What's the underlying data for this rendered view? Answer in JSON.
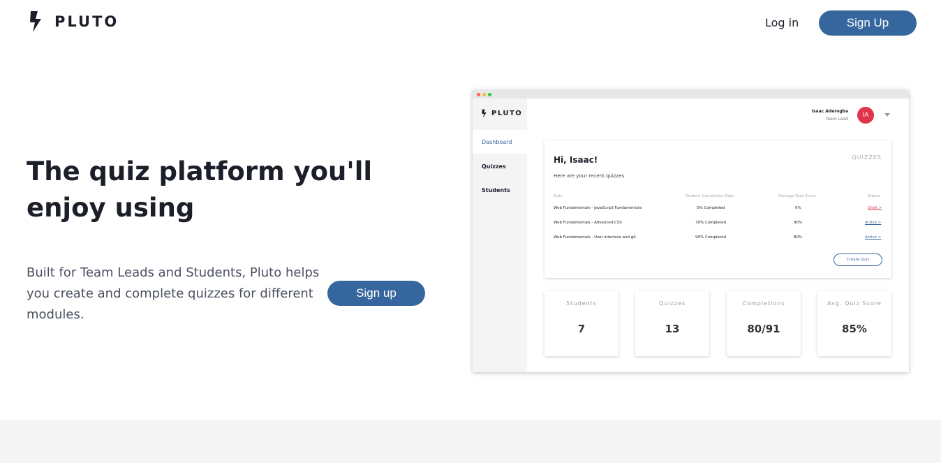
{
  "brand": {
    "name": "PLUTO",
    "icon": "bolt-icon"
  },
  "nav": {
    "login_label": "Log in",
    "signup_label": "Sign Up"
  },
  "hero": {
    "title": "The quiz platform you'll enjoy using",
    "description": "Built for Team Leads and Students, Pluto helps you create and complete quizzes for different modules.",
    "cta_label": "Sign up"
  },
  "colors": {
    "primary": "#35669d",
    "avatar": "#e0344a",
    "draft": "#e0344a",
    "active": "#35669d",
    "footer_band": "#f4f4f4"
  },
  "mockup": {
    "brand": "PLUTO",
    "sidebar": [
      {
        "label": "Dashboard",
        "active": true
      },
      {
        "label": "Quizzes",
        "active": false
      },
      {
        "label": "Students",
        "active": false
      }
    ],
    "user": {
      "name": "Isaac Aderogba",
      "role": "Team Lead",
      "initials": "IA"
    },
    "card": {
      "greeting": "Hi, Isaac!",
      "section_label": "QUIZZES",
      "subtitle": "Here are your recent quizzes",
      "columns": [
        "Quiz",
        "Student Completion Rate",
        "Average Quiz Score",
        "Status"
      ],
      "rows": [
        {
          "quiz": "Web Fundamentals - JavaScript Fundamentals",
          "completion": "0% Completed",
          "score": "0%",
          "status": "Draft >"
        },
        {
          "quiz": "Web Fundamentals - Advanced CSS",
          "completion": "70% Completed",
          "score": "90%",
          "status": "Active >"
        },
        {
          "quiz": "Web Fundamentals - User interface and git",
          "completion": "90% Completed",
          "score": "80%",
          "status": "Active >"
        }
      ],
      "create_label": "Create Quiz"
    },
    "stats": [
      {
        "label": "Students",
        "value": "7"
      },
      {
        "label": "Quizzes",
        "value": "13"
      },
      {
        "label": "Completions",
        "value": "80/91"
      },
      {
        "label": "Avg. Quiz Score",
        "value": "85%"
      }
    ]
  }
}
